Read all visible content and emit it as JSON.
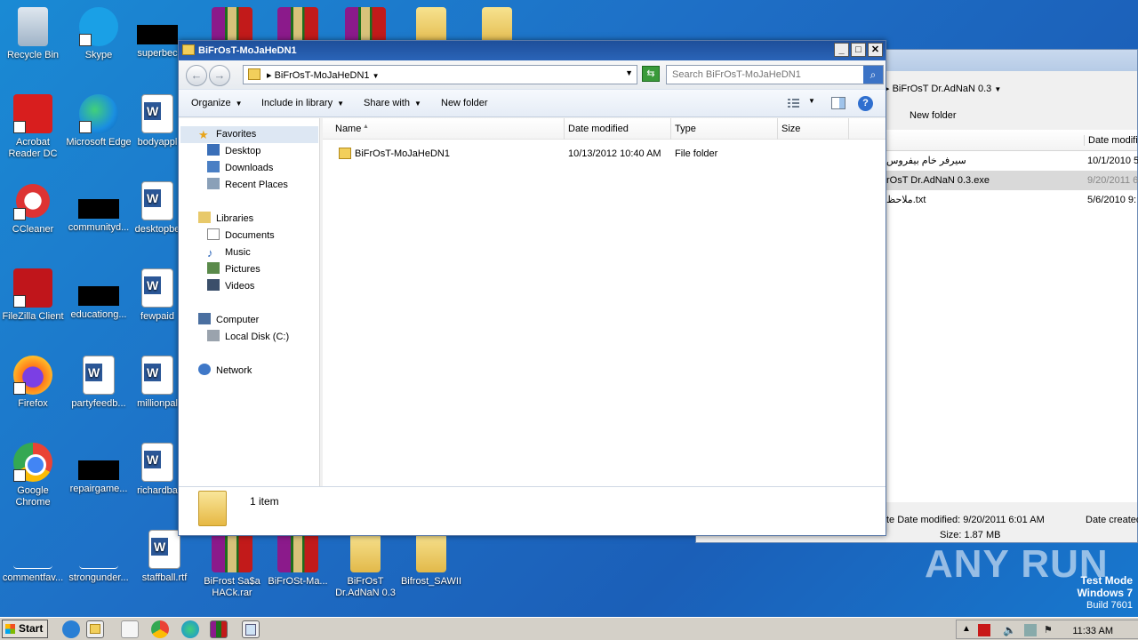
{
  "desktop": {
    "icons": [
      {
        "label": "Recycle Bin"
      },
      {
        "label": "Skype"
      },
      {
        "label": "superbec"
      },
      {
        "label": "Acrobat Reader DC"
      },
      {
        "label": "Microsoft Edge"
      },
      {
        "label": "bodyappl"
      },
      {
        "label": "CCleaner"
      },
      {
        "label": "communityd..."
      },
      {
        "label": "desktopbe"
      },
      {
        "label": "FileZilla Client"
      },
      {
        "label": "educationg..."
      },
      {
        "label": "fewpaid"
      },
      {
        "label": "Firefox"
      },
      {
        "label": "partyfeedb..."
      },
      {
        "label": "millionpal"
      },
      {
        "label": "Google Chrome"
      },
      {
        "label": "repairgame..."
      },
      {
        "label": "richardba"
      },
      {
        "label": "commentfav..."
      },
      {
        "label": "strongunder..."
      },
      {
        "label": "staffball.rtf"
      },
      {
        "label": "BiFrost Sa$a HACk.rar"
      },
      {
        "label": "BiFrOSt-Ma..."
      },
      {
        "label": "BiFrOsT Dr.AdNaN 0.3"
      },
      {
        "label": "Bifrost_SAWII"
      }
    ]
  },
  "bg_window": {
    "address": "BiFrOsT Dr.AdNaN 0.3",
    "new_folder": "New folder",
    "col_date": "Date modifi",
    "rows": [
      {
        "name": "سيرفر خام بيفروس",
        "date": "10/1/2010 5"
      },
      {
        "name": "rOsT Dr.AdNaN 0.3.exe",
        "date": "9/20/2011 6"
      },
      {
        "name": "ملاحظ.txt",
        "date": "5/6/2010 9:"
      }
    ],
    "detail_modified": "te  Date modified: 9/20/2011 6:01 AM",
    "detail_created": "Date created",
    "detail_size": "Size: 1.87 MB"
  },
  "window": {
    "title": "BiFrOsT-MoJaHeDN1",
    "address": "BiFrOsT-MoJaHeDN1",
    "search_placeholder": "Search BiFrOsT-MoJaHeDN1",
    "toolbar": {
      "organize": "Organize",
      "include": "Include in library",
      "share": "Share with",
      "new_folder": "New folder"
    },
    "nav": {
      "favorites": "Favorites",
      "desktop": "Desktop",
      "downloads": "Downloads",
      "recent": "Recent Places",
      "libraries": "Libraries",
      "documents": "Documents",
      "music": "Music",
      "pictures": "Pictures",
      "videos": "Videos",
      "computer": "Computer",
      "local_disk": "Local Disk (C:)",
      "network": "Network"
    },
    "columns": {
      "name": "Name",
      "date": "Date modified",
      "type": "Type",
      "size": "Size"
    },
    "files": [
      {
        "name": "BiFrOsT-MoJaHeDN1",
        "date": "10/13/2012 10:40 AM",
        "type": "File folder",
        "size": ""
      }
    ],
    "status": "1 item"
  },
  "watermark": "ANY RUN",
  "testmode": {
    "line1": "Test Mode",
    "line2": "Windows 7",
    "line3": "Build 7601"
  },
  "taskbar": {
    "start": "Start",
    "clock": "11:33 AM"
  }
}
